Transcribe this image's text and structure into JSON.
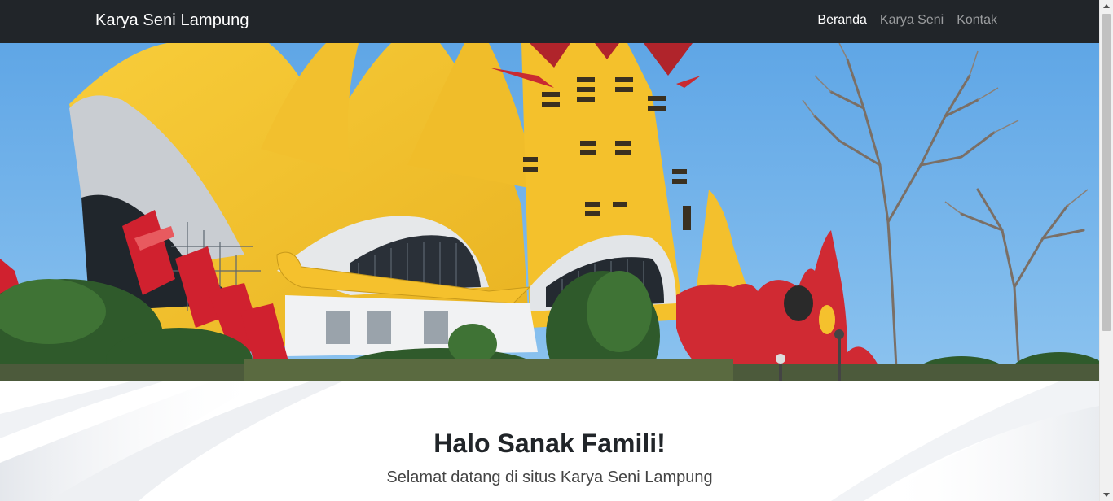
{
  "navbar": {
    "brand": "Karya Seni Lampung",
    "items": [
      {
        "label": "Beranda",
        "active": true
      },
      {
        "label": "Karya Seni",
        "active": false
      },
      {
        "label": "Kontak",
        "active": false
      }
    ]
  },
  "hero": {
    "image": "tugu-siger-lampung-photo"
  },
  "welcome": {
    "title": "Halo Sanak Famili!",
    "subtitle": "Selamat datang di situs Karya Seni Lampung"
  },
  "colors": {
    "navbar_bg": "#212529",
    "nav_active": "#ffffff",
    "nav_inactive": "rgba(255,255,255,0.55)",
    "sky": "#6fb1e8",
    "siger_yellow": "#f6c531",
    "siger_red": "#d02a33"
  }
}
